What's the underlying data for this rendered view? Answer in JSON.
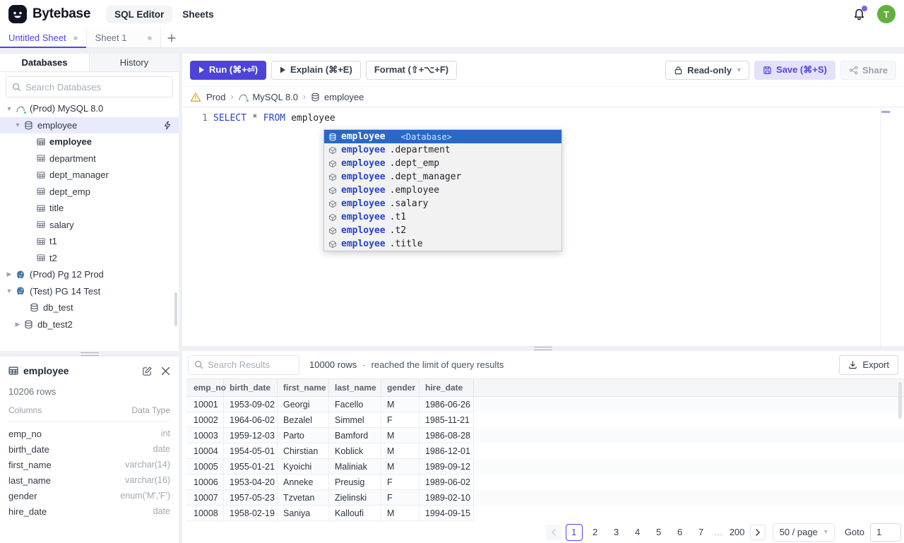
{
  "app": {
    "brand": "Bytebase",
    "nav_sql_editor": "SQL Editor",
    "nav_sheets": "Sheets",
    "avatar_initial": "T"
  },
  "sheet_tabs": {
    "tab1": "Untitled Sheet",
    "tab2": "Sheet 1"
  },
  "sidebar": {
    "tab_databases": "Databases",
    "tab_history": "History",
    "search_placeholder": "Search Databases",
    "tree": [
      "(Prod) MySQL 8.0",
      "employee",
      "employee",
      "department",
      "dept_manager",
      "dept_emp",
      "title",
      "salary",
      "t1",
      "t2",
      "(Prod) Pg 12 Prod",
      "(Test) PG 14 Test",
      "db_test",
      "db_test2"
    ]
  },
  "schema_panel": {
    "table_name": "employee",
    "row_count": "10206 rows",
    "columns_header": "Columns",
    "datatype_header": "Data Type",
    "columns": [
      {
        "name": "emp_no",
        "type": "int"
      },
      {
        "name": "birth_date",
        "type": "date"
      },
      {
        "name": "first_name",
        "type": "varchar(14)"
      },
      {
        "name": "last_name",
        "type": "varchar(16)"
      },
      {
        "name": "gender",
        "type": "enum('M','F')"
      },
      {
        "name": "hire_date",
        "type": "date"
      }
    ]
  },
  "toolbar": {
    "run": "Run (⌘+⏎)",
    "explain": "Explain (⌘+E)",
    "format": "Format (⇧+⌥+F)",
    "read_only": "Read-only",
    "save": "Save (⌘+S)",
    "share": "Share"
  },
  "breadcrumb": {
    "env": "Prod",
    "instance": "MySQL 8.0",
    "database": "employee"
  },
  "editor": {
    "line_number": "1",
    "kw_select": "SELECT",
    "star": "*",
    "kw_from": "FROM",
    "table": "employee"
  },
  "autocomplete": {
    "selected": {
      "name": "employee",
      "kind": "<Database>"
    },
    "items": [
      {
        "db": "employee",
        "rest": ".department"
      },
      {
        "db": "employee",
        "rest": ".dept_emp"
      },
      {
        "db": "employee",
        "rest": ".dept_manager"
      },
      {
        "db": "employee",
        "rest": ".employee"
      },
      {
        "db": "employee",
        "rest": ".salary"
      },
      {
        "db": "employee",
        "rest": ".t1"
      },
      {
        "db": "employee",
        "rest": ".t2"
      },
      {
        "db": "employee",
        "rest": ".title"
      }
    ]
  },
  "results": {
    "search_placeholder": "Search Results",
    "row_count": "10000 rows",
    "separator": "-",
    "limit_note": "reached the limit of query results",
    "export_label": "Export",
    "table": {
      "headers": [
        "emp_no",
        "birth_date",
        "first_name",
        "last_name",
        "gender",
        "hire_date"
      ],
      "rows": [
        [
          "10001",
          "1953-09-02",
          "Georgi",
          "Facello",
          "M",
          "1986-06-26"
        ],
        [
          "10002",
          "1964-06-02",
          "Bezalel",
          "Simmel",
          "F",
          "1985-11-21"
        ],
        [
          "10003",
          "1959-12-03",
          "Parto",
          "Bamford",
          "M",
          "1986-08-28"
        ],
        [
          "10004",
          "1954-05-01",
          "Chirstian",
          "Koblick",
          "M",
          "1986-12-01"
        ],
        [
          "10005",
          "1955-01-21",
          "Kyoichi",
          "Maliniak",
          "M",
          "1989-09-12"
        ],
        [
          "10006",
          "1953-04-20",
          "Anneke",
          "Preusig",
          "F",
          "1989-06-02"
        ],
        [
          "10007",
          "1957-05-23",
          "Tzvetan",
          "Zielinski",
          "F",
          "1989-02-10"
        ],
        [
          "10008",
          "1958-02-19",
          "Saniya",
          "Kalloufi",
          "M",
          "1994-09-15"
        ]
      ]
    },
    "pagination": {
      "pages": [
        "1",
        "2",
        "3",
        "4",
        "5",
        "6",
        "7"
      ],
      "ellipsis": "…",
      "last_page": "200",
      "per_page": "50 / page",
      "goto_label": "Goto",
      "goto_value": "1"
    }
  }
}
